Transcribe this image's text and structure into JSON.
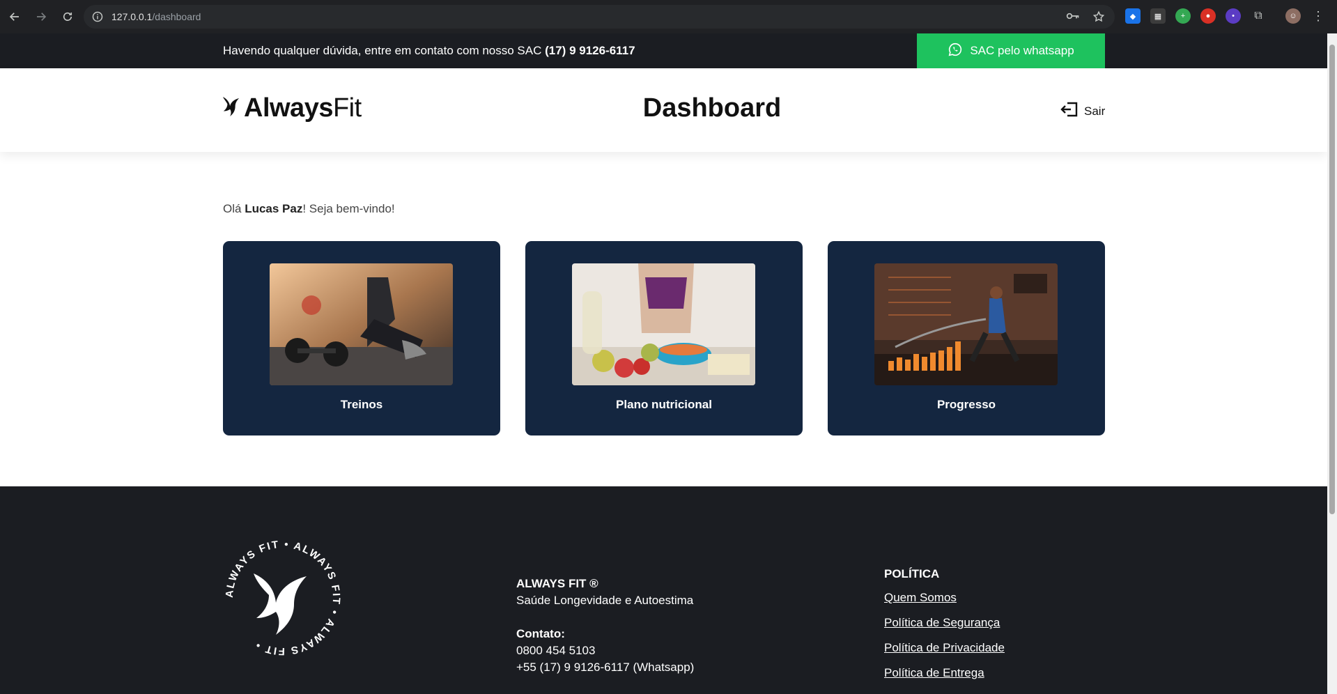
{
  "browser": {
    "url_host": "127.0.0.1",
    "url_path": "/dashboard"
  },
  "topbar": {
    "message": "Havendo qualquer dúvida, entre em contato com nosso SAC ",
    "phone": "(17) 9 9126-6117",
    "sac_button_label": "SAC pelo whatsapp"
  },
  "header": {
    "logo_bold": "Always",
    "logo_light": "Fit",
    "title": "Dashboard",
    "logout_label": "Sair"
  },
  "greeting": {
    "prefix": "Olá ",
    "user_name": "Lucas Paz",
    "suffix": "! Seja bem-vindo!"
  },
  "cards": [
    {
      "label": "Treinos",
      "image": "workout-photo"
    },
    {
      "label": "Plano nutricional",
      "image": "nutrition-photo"
    },
    {
      "label": "Progresso",
      "image": "progress-photo"
    }
  ],
  "footer": {
    "seal_text": "ALWAYS FIT • ALWAYS FIT • ALWAYS FIT •",
    "brand": "ALWAYS FIT ®",
    "tagline": "Saúde Longevidade e Autoestima",
    "contact_heading": "Contato:",
    "phone": "0800 454 5103",
    "whatsapp": "+55 (17) 9 9126-6117 (Whatsapp)",
    "policy_heading": "POLÍTICA",
    "policy_links": [
      "Quem Somos",
      "Política de Segurança",
      "Política de Privacidade",
      "Política de Entrega"
    ]
  },
  "colors": {
    "dark_bar": "#1b1d22",
    "whatsapp_green": "#1ec25e",
    "card_navy": "#142640"
  }
}
